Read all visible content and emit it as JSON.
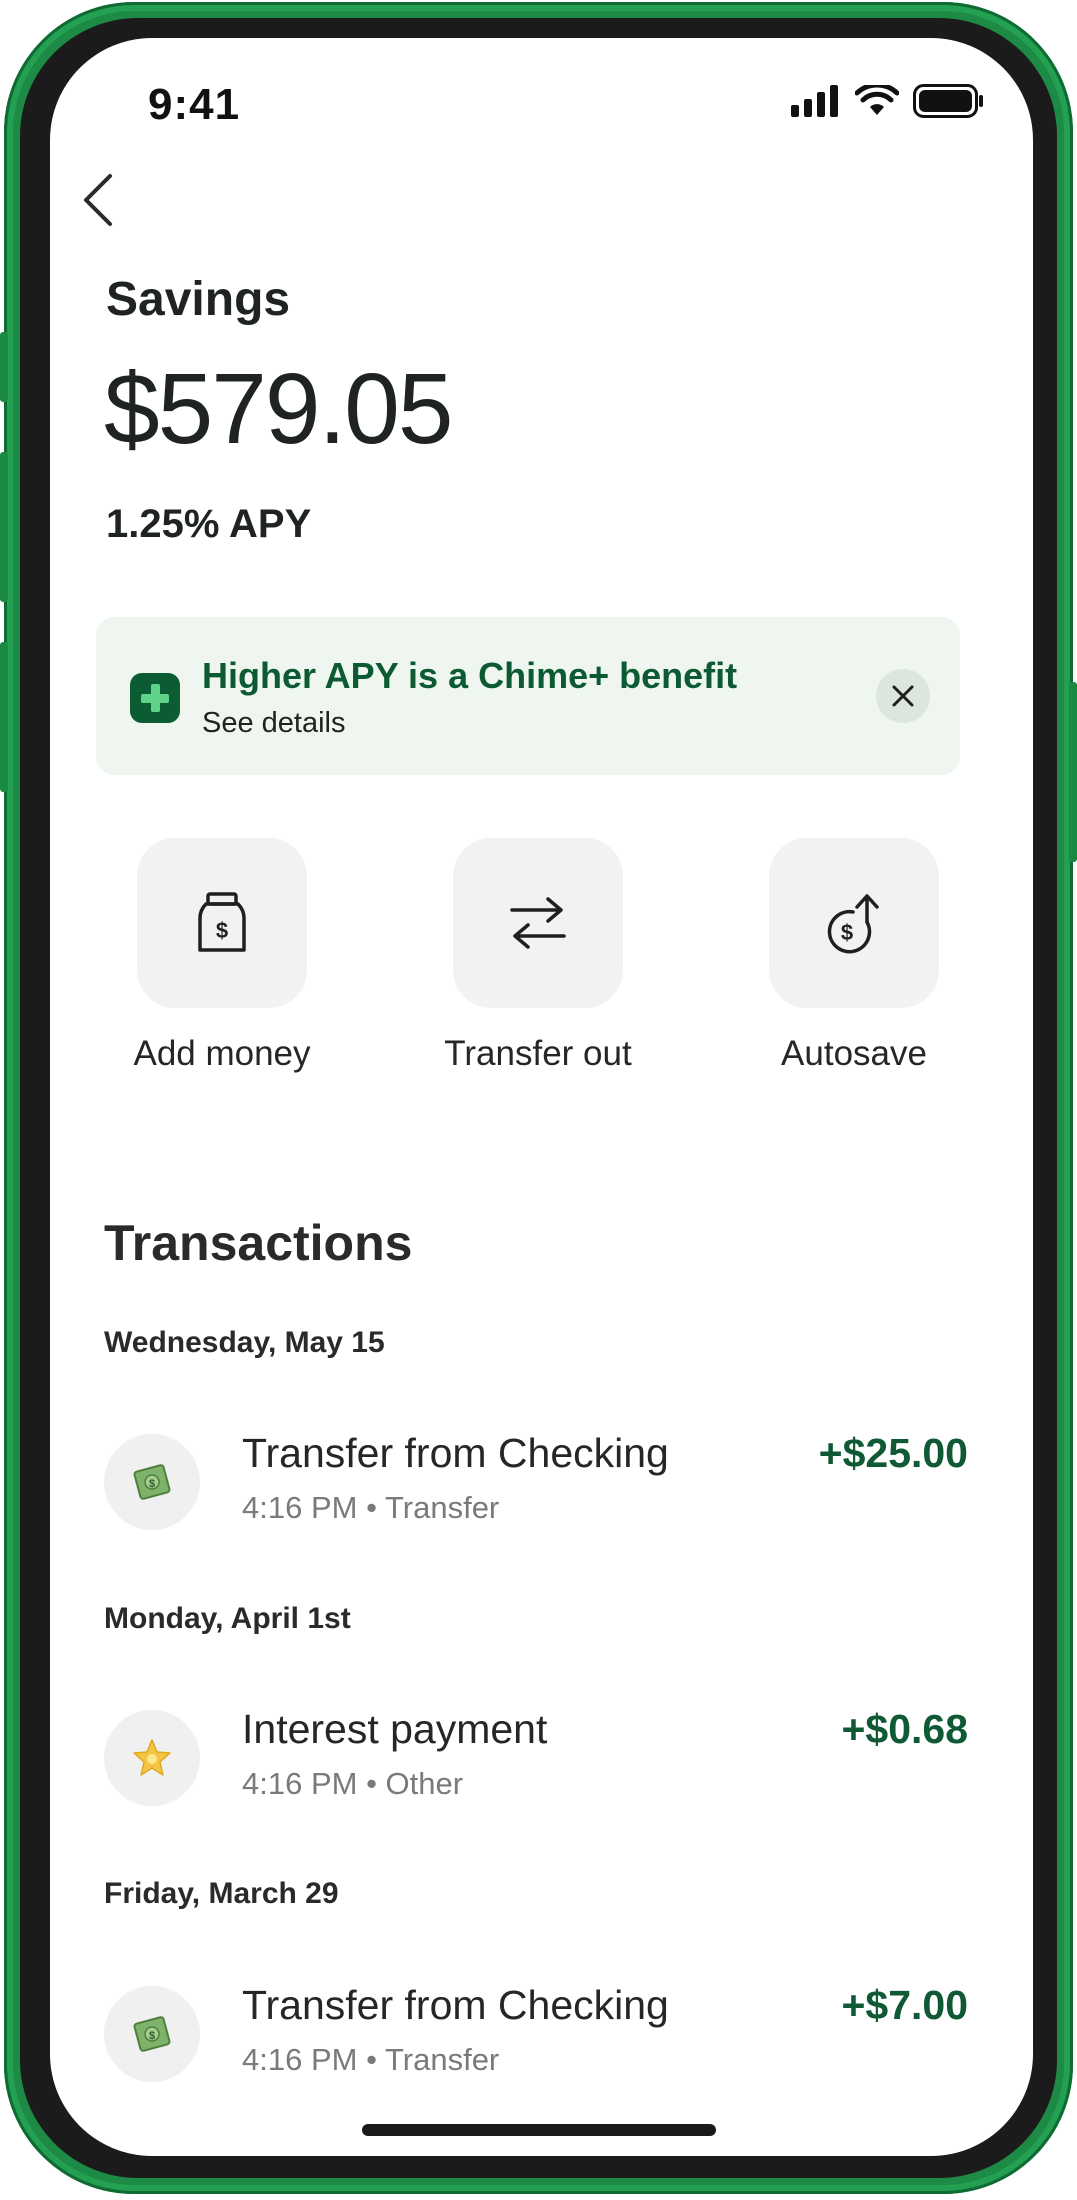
{
  "status_bar": {
    "time": "9:41"
  },
  "header": {
    "title": "Savings",
    "balance": "$579.05",
    "apy": "1.25% APY"
  },
  "banner": {
    "title": "Higher APY is a Chime+ benefit",
    "subtitle": "See details"
  },
  "actions": [
    {
      "label": "Add money",
      "icon": "money-jar-icon"
    },
    {
      "label": "Transfer out",
      "icon": "transfer-arrows-icon"
    },
    {
      "label": "Autosave",
      "icon": "autosave-dollar-icon"
    }
  ],
  "transactions": {
    "title": "Transactions",
    "groups": [
      {
        "date": "Wednesday, May 15",
        "name": "Transfer from Checking",
        "time": "4:16 PM",
        "category": "Transfer",
        "amount": "+$25.00",
        "icon": "money-with-wings-icon"
      },
      {
        "date": "Monday, April 1st",
        "name": "Interest payment",
        "time": "4:16 PM",
        "category": "Other",
        "amount": "+$0.68",
        "icon": "star-icon"
      },
      {
        "date": "Friday, March 29",
        "name": "Transfer from Checking",
        "time": "4:16 PM",
        "category": "Transfer",
        "amount": "+$7.00",
        "icon": "money-with-wings-icon"
      }
    ]
  },
  "colors": {
    "frame": "#1d8a45",
    "brand_green": "#0b5a32",
    "banner_bg": "#eef6ef",
    "amount_green": "#0f5a34"
  }
}
